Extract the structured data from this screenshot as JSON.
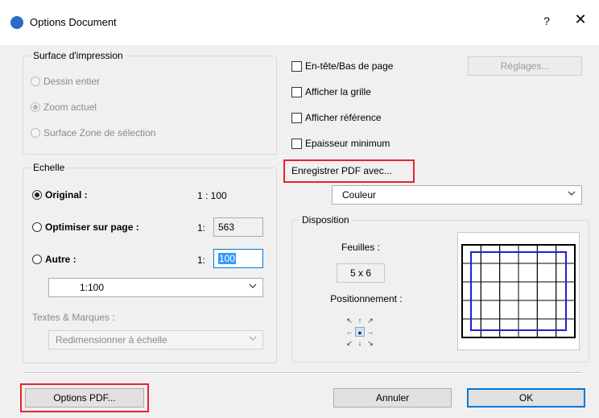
{
  "window": {
    "title": "Options Document",
    "help": "?",
    "close": "✕"
  },
  "print_area": {
    "legend": "Surface d'impression",
    "options": [
      "Dessin entier",
      "Zoom actuel",
      "Surface Zone de sélection"
    ]
  },
  "scale": {
    "legend": "Echelle",
    "original_label": "Original :",
    "original_value": "1 : 100",
    "fit_label": "Optimiser sur page :",
    "fit_prefix": "1:",
    "fit_value": "563",
    "other_label": "Autre :",
    "other_prefix": "1:",
    "other_value": "100",
    "scale_select": "1:100",
    "texts_label": "Textes & Marques :",
    "texts_select": "Redimensionner à échelle"
  },
  "options": {
    "header_footer": "En-tête/Bas de page",
    "settings_button": "Réglages...",
    "show_grid": "Afficher la grille",
    "show_reference": "Afficher référence",
    "min_thickness": "Epaisseur minimum",
    "save_pdf_with": "Enregistrer PDF avec...",
    "color_select": "Couleur"
  },
  "layout": {
    "legend": "Disposition",
    "sheets_label": "Feuilles :",
    "sheets_value": "5 x 6",
    "positioning_label": "Positionnement :",
    "sheet_columns": 6,
    "sheet_rows": 5
  },
  "buttons": {
    "pdf_options": "Options PDF...",
    "cancel": "Annuler",
    "ok": "OK"
  },
  "colors": {
    "accent": "#0078d7",
    "highlight": "#e8232f",
    "sheet_frame": "#1f1fd6"
  }
}
